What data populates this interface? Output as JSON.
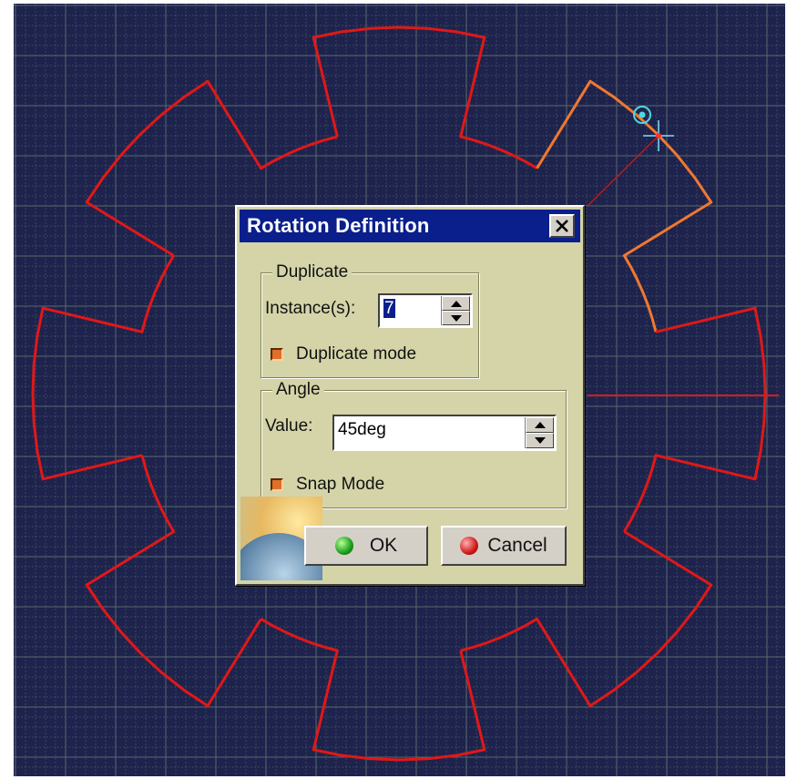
{
  "colors": {
    "viewport_bg": "#1e234d",
    "grid_line": "#5a6a6a",
    "gear_profile": "#e01818",
    "highlight_profile": "#f07830",
    "dialog_bg": "#d4d4a8",
    "titlebar_bg": "#0a1f8c"
  },
  "dialog": {
    "title": "Rotation Definition",
    "duplicate": {
      "legend": "Duplicate",
      "instances_label": "Instance(s):",
      "instances_value": "7",
      "duplicate_mode_label": "Duplicate mode",
      "duplicate_mode_checked": true
    },
    "angle": {
      "legend": "Angle",
      "value_label": "Value:",
      "value": "45deg",
      "snap_mode_label": "Snap Mode",
      "snap_mode_checked": true
    },
    "ok_label": "OK",
    "cancel_label": "Cancel"
  },
  "icons": [
    "close-icon",
    "spin-up-icon",
    "spin-down-icon",
    "ok-icon",
    "cancel-icon",
    "rotation-point-icon",
    "crosshair-icon",
    "globe-icon"
  ]
}
